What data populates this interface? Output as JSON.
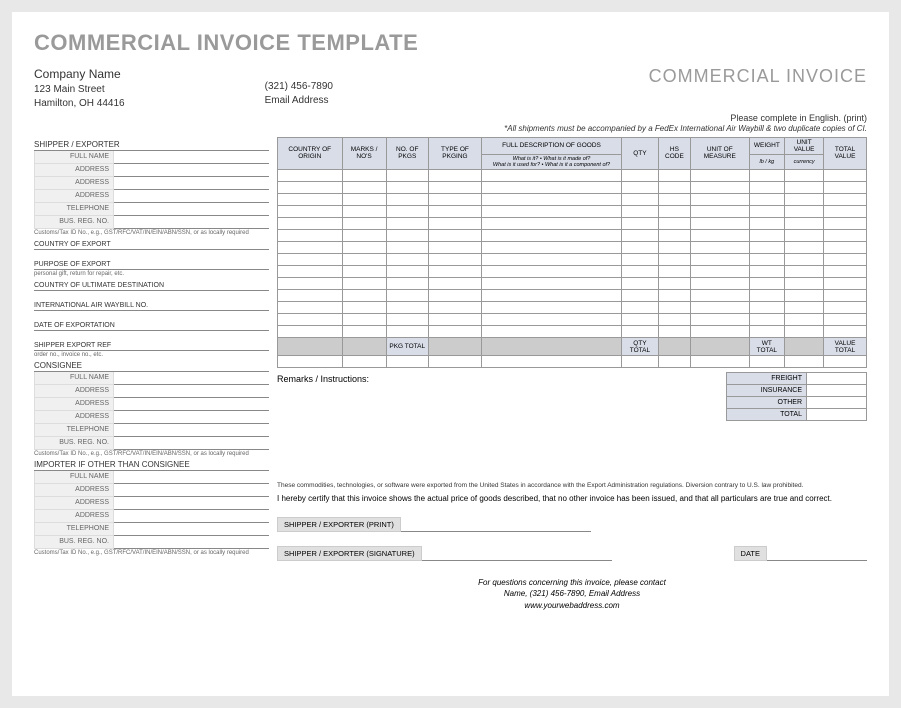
{
  "mainTitle": "COMMERCIAL INVOICE TEMPLATE",
  "docTitle": "COMMERCIAL INVOICE",
  "company": {
    "name": "Company Name",
    "street": "123 Main Street",
    "cityLine": "Hamilton, OH  44416"
  },
  "contact": {
    "phone": "(321) 456-7890",
    "email": "Email Address"
  },
  "noteTop": "Please complete in English. (print)",
  "noteItalic": "*All shipments must be accompanied by a FedEx International Air Waybill & two duplicate copies of CI.",
  "shipperHdr": "SHIPPER / EXPORTER",
  "fields": {
    "fullName": "FULL NAME",
    "address": "ADDRESS",
    "telephone": "TELEPHONE",
    "busReg": "BUS. REG. NO."
  },
  "customsNote": "Customs/Tax ID No., e.g., GST/RFC/VAT/IN/EIN/ABN/SSN, or as locally required",
  "countryExport": "COUNTRY OF EXPORT",
  "purposeExport": "PURPOSE OF EXPORT",
  "purposeNote": "personal gift, return for repair, etc.",
  "countryDest": "COUNTRY OF ULTIMATE DESTINATION",
  "airWaybill": "INTERNATIONAL AIR WAYBILL NO.",
  "dateExport": "DATE OF EXPORTATION",
  "shipperRef": "SHIPPER EXPORT REF",
  "orderNote": "order no., invoice no., etc.",
  "consigneeHdr": "CONSIGNEE",
  "importerHdr": "IMPORTER IF OTHER THAN CONSIGNEE",
  "cols": {
    "origin": "COUNTRY OF ORIGIN",
    "marks": "MARKS / NO'S",
    "pkgs": "NO. OF PKGS",
    "pkging": "TYPE OF PKGING",
    "desc": "FULL DESCRIPTION OF GOODS",
    "descSub": "What is it? • What is it made of?\nWhat is it used for? • What is it a component of?",
    "qty": "QTY",
    "hs": "HS CODE",
    "unit": "UNIT OF MEASURE",
    "weight": "WEIGHT",
    "weightSub": "lb / kg",
    "unitVal": "UNIT VALUE",
    "unitValSub": "currency",
    "total": "TOTAL VALUE"
  },
  "totals": {
    "pkgTotal": "PKG TOTAL",
    "qtyTotal": "QTY TOTAL",
    "wtTotal": "WT TOTAL",
    "valueTotal": "VALUE TOTAL"
  },
  "remarks": "Remarks / Instructions:",
  "summary": {
    "freight": "FREIGHT",
    "insurance": "INSURANCE",
    "other": "OTHER",
    "total": "TOTAL"
  },
  "disclaimer": "These commodities, technologies, or software were exported from the United States in accordance with the Export Administration regulations. Diversion contrary to U.S. law prohibited.",
  "cert": "I hereby certify that this invoice shows the actual price of goods described, that no other invoice has been issued, and that all particulars are true and correct.",
  "sig": {
    "print": "SHIPPER / EXPORTER (PRINT)",
    "signature": "SHIPPER / EXPORTER (SIGNATURE)",
    "date": "DATE"
  },
  "footer": {
    "line1": "For questions concerning this invoice, please contact",
    "line2": "Name, (321) 456-7890, Email Address",
    "line3": "www.yourwebaddress.com"
  }
}
